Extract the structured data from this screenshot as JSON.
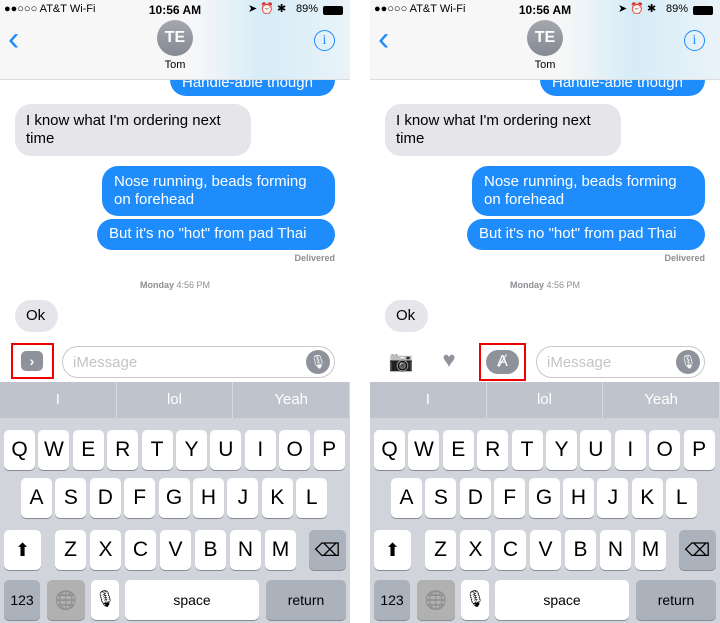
{
  "status": {
    "carrier": "●●○○○ AT&T Wi-Fi",
    "time": "10:56 AM",
    "battery": "89%"
  },
  "nav": {
    "back": "‹",
    "avatar_initials": "TE",
    "contact": "Tom",
    "info": "i"
  },
  "messages": [
    {
      "from": "me",
      "text": "Handle-able though"
    },
    {
      "from": "them",
      "text": "I know what I'm ordering next time"
    },
    {
      "from": "me",
      "text": "Nose running, beads forming on forehead"
    },
    {
      "from": "me",
      "text": "But it's no \"hot\" from pad Thai"
    },
    {
      "from": "them",
      "text": "Ok"
    }
  ],
  "delivered": "Delivered",
  "timestamp": {
    "day": "Monday",
    "time": "4:56 PM"
  },
  "input": {
    "placeholder": "iMessage"
  },
  "suggestions": [
    "I",
    "lol",
    "Yeah"
  ],
  "keys": {
    "row1": [
      "Q",
      "W",
      "E",
      "R",
      "T",
      "Y",
      "U",
      "I",
      "O",
      "P"
    ],
    "row2": [
      "A",
      "S",
      "D",
      "F",
      "G",
      "H",
      "J",
      "K",
      "L"
    ],
    "row3": [
      "Z",
      "X",
      "C",
      "V",
      "B",
      "N",
      "M"
    ],
    "numbers": "123",
    "space": "space",
    "return": "return"
  },
  "colors": {
    "accent": "#1e8cfb",
    "highlight": "#e00000"
  },
  "panels": [
    {
      "variant": "collapsed",
      "highlighted": "expand-button"
    },
    {
      "variant": "expanded",
      "highlighted": "app-store-button"
    }
  ]
}
